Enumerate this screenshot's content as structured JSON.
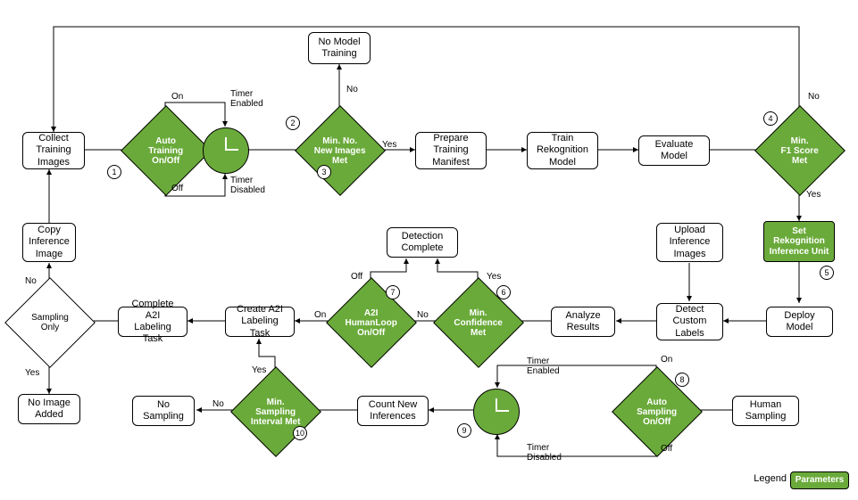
{
  "nodes": {
    "collect_training": "Collect\nTraining\nImages",
    "no_model_training": "No Model\nTraining",
    "prepare_manifest": "Prepare\nTraining\nManifest",
    "train_model": "Train\nRekognition\nModel",
    "evaluate_model": "Evaluate\nModel",
    "copy_inference": "Copy\nInference\nImage",
    "detection_complete": "Detection\nComplete",
    "upload_inference": "Upload\nInference\nImages",
    "complete_a2i": "Complete A2I\nLabeling Task",
    "create_a2i": "Create A2I\nLabeling Task",
    "analyze_results": "Analyze\nResults",
    "detect_labels": "Detect\nCustom\nLabels",
    "deploy_model": "Deploy\nModel",
    "no_image_added": "No Image\nAdded",
    "no_sampling": "No\nSampling",
    "count_inferences": "Count New\nInferences",
    "human_sampling": "Human\nSampling"
  },
  "diamonds": {
    "auto_training": "Auto\nTraining\nOn/Off",
    "min_images": "Min. No.\nNew Images\nMet",
    "min_f1": "Min.\nF1 Score\nMet",
    "min_conf": "Min.\nConfidence\nMet",
    "a2i_loop": "A2I\nHumanLoop\nOn/Off",
    "auto_sampling": "Auto\nSampling\nOn/Off",
    "min_sampling": "Min.\nSampling\nInterval Met",
    "sampling_only": "Sampling\nOnly"
  },
  "greenboxes": {
    "set_inference_unit": "Set\nRekognition\nInference Unit"
  },
  "labels": {
    "on": "On",
    "off": "Off",
    "timer_enabled": "Timer\nEnabled",
    "timer_disabled": "Timer\nDisabled",
    "yes": "Yes",
    "no": "No"
  },
  "legend": {
    "legend_label": "Legend",
    "parameters": "Parameters"
  },
  "numbers": [
    "1",
    "2",
    "3",
    "4",
    "5",
    "6",
    "7",
    "8",
    "9",
    "10"
  ]
}
